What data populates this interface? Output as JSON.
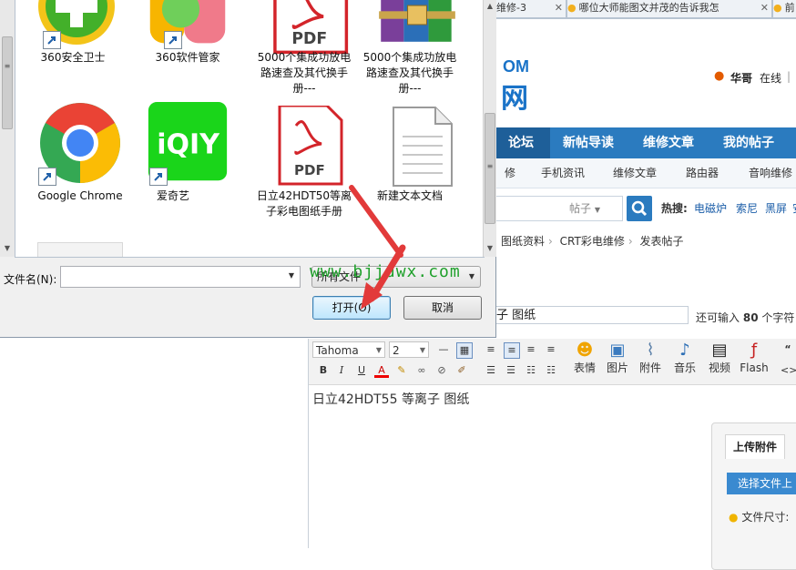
{
  "browser": {
    "tabs": [
      {
        "label": "维修-3"
      },
      {
        "label": "哪位大师能图文并茂的告诉我怎"
      },
      {
        "label": "前"
      }
    ]
  },
  "site": {
    "logo_text": "OM",
    "logo_big": "网",
    "user_name": "华哥",
    "online_label": "在线",
    "separator": "|",
    "nav": [
      "论坛",
      "新帖导读",
      "维修文章",
      "我的帖子"
    ],
    "subnav": [
      "修",
      "手机资讯",
      "维修文章",
      "路由器",
      "音响维修"
    ],
    "search": {
      "type_label": "帖子"
    },
    "hot": {
      "label": "热搜:",
      "links": [
        "电磁炉",
        "索尼",
        "黑屏",
        "安"
      ]
    },
    "breadcrumb": [
      "图纸资料",
      "CRT彩电维修",
      "发表帖子"
    ],
    "breadcrumb_sep": "›"
  },
  "post": {
    "title_value": "子 图纸",
    "remain_prefix": "还可输入",
    "remain_count": "80",
    "remain_suffix": "个字符",
    "content": "日立42HDT55 等离子 图纸"
  },
  "toolbar": {
    "font": "Tahoma",
    "size": "2",
    "bold": "B",
    "italic": "I",
    "underline": "U",
    "font_color": "A",
    "items": [
      {
        "label": "表情",
        "icon": "smile-icon"
      },
      {
        "label": "图片",
        "icon": "image-icon"
      },
      {
        "label": "附件",
        "icon": "paperclip-icon"
      },
      {
        "label": "音乐",
        "icon": "music-icon"
      },
      {
        "label": "视频",
        "icon": "video-icon"
      },
      {
        "label": "Flash",
        "icon": "flash-icon"
      }
    ],
    "quote": "“",
    "code": "<>"
  },
  "upload": {
    "tab_label": "上传附件",
    "select_button": "选择文件上",
    "file_size_label": "文件尺寸:"
  },
  "dialog": {
    "files": [
      {
        "label": "360安全卫士",
        "icon": "360-security-icon"
      },
      {
        "label": "360软件管家",
        "icon": "360-software-manager-icon"
      },
      {
        "label": "5000个集成功放电路速查及其代换手册---",
        "icon": "pdf-icon"
      },
      {
        "label": "5000个集成功放电路速查及其代换手册---",
        "icon": "winrar-archive-icon"
      },
      {
        "label": "Google Chrome",
        "icon": "chrome-icon"
      },
      {
        "label": "爱奇艺",
        "icon": "iqiyi-icon"
      },
      {
        "label": "日立42HDT50等离子彩电图纸手册",
        "icon": "pdf-icon"
      },
      {
        "label": "新建文本文档",
        "icon": "text-document-icon"
      }
    ],
    "filename_label": "文件名(N):",
    "filename_value": "",
    "filetype_value": "所有文件",
    "open_button": "打开(O)",
    "cancel_button": "取消",
    "pdf_badge": "PDF",
    "iqiyi_text": "iQIY"
  },
  "watermark": "www.bjjdwx.com",
  "colors": {
    "nav_blue": "#2b7bbf",
    "link_blue": "#1a5da8",
    "watermark_green": "#1fa02b",
    "arrow_red": "#e23a3a"
  }
}
